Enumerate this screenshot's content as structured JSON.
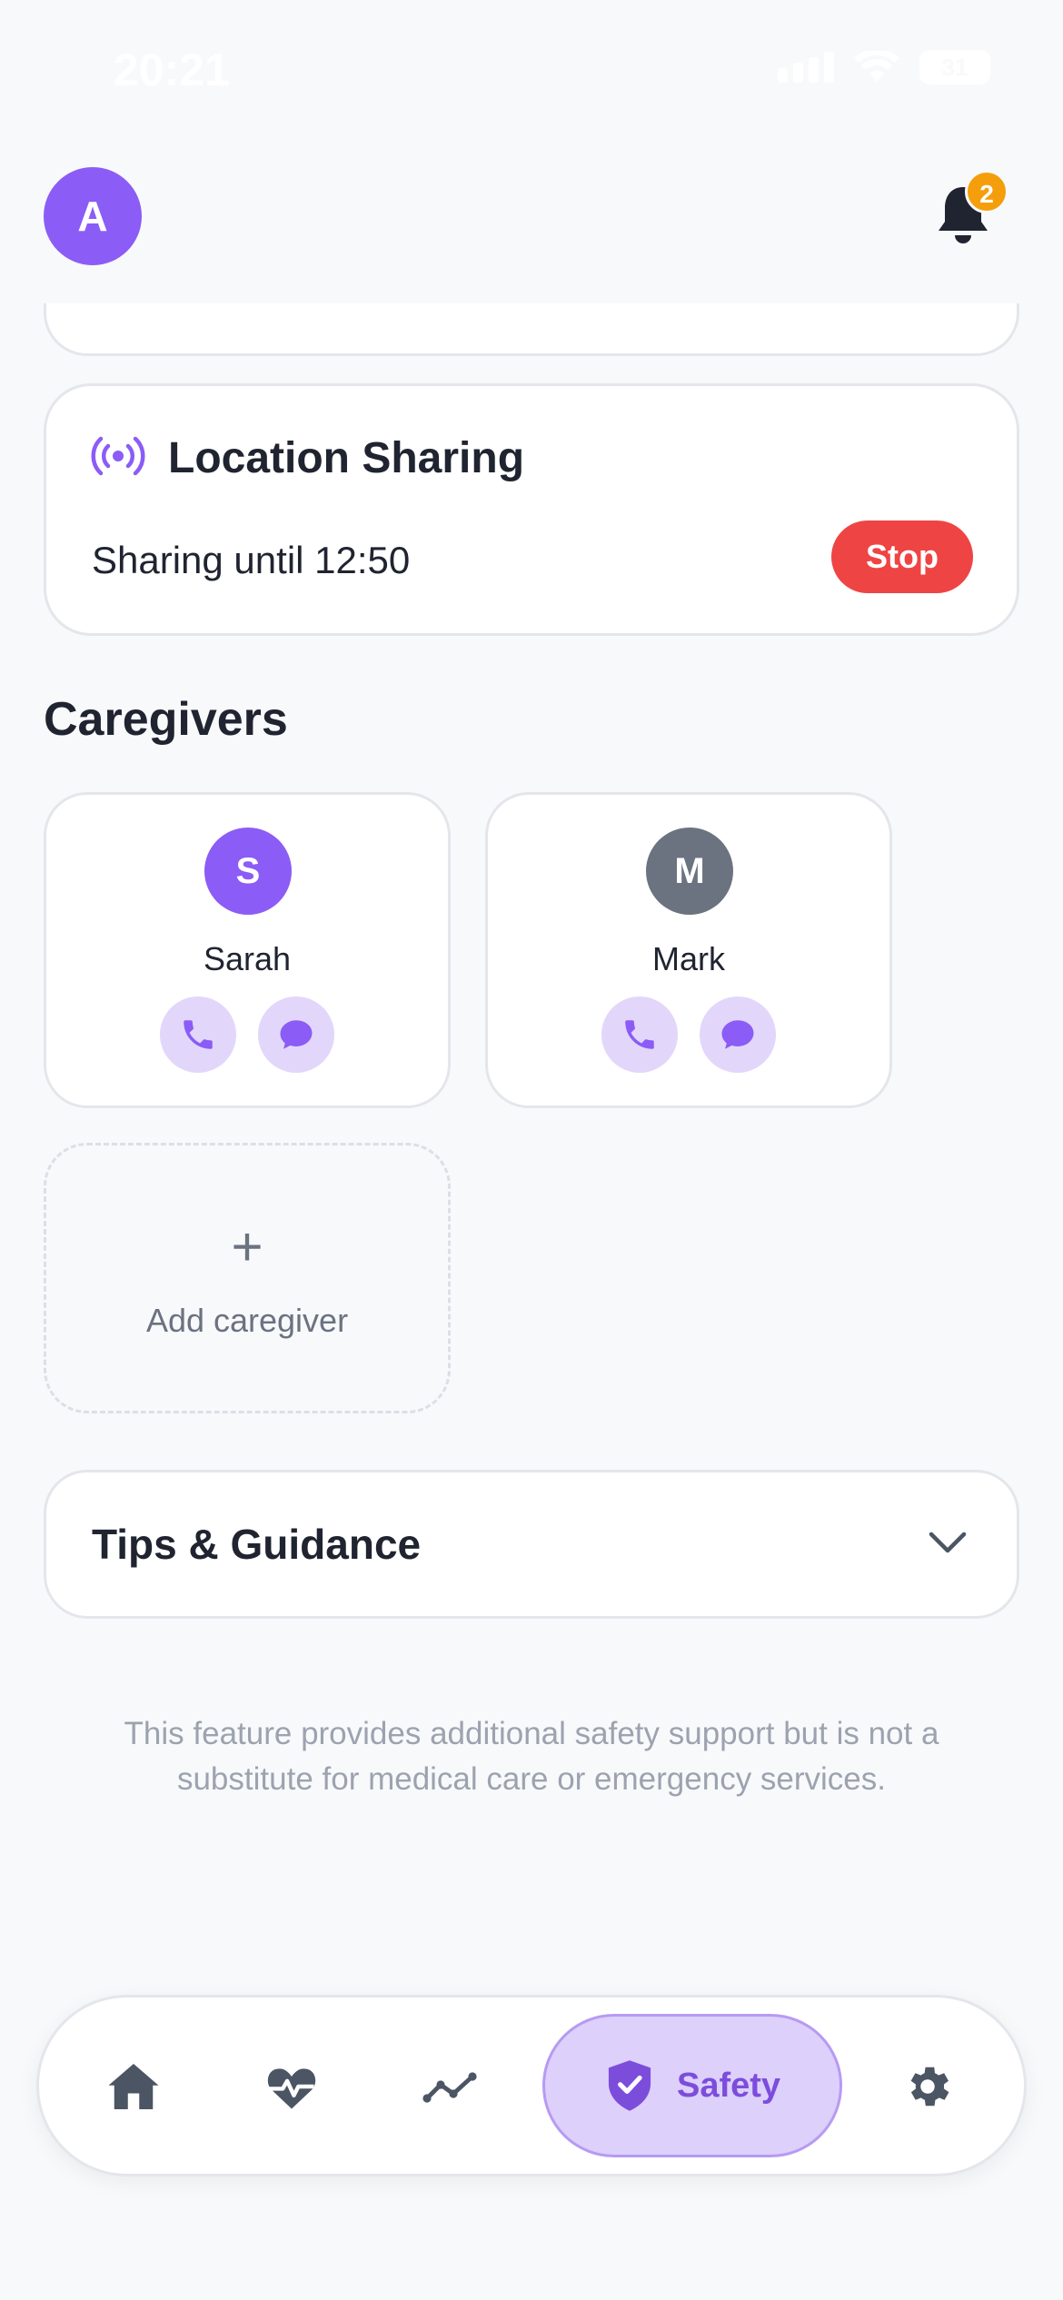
{
  "status_bar": {
    "time": "20:21",
    "battery": "31"
  },
  "header": {
    "avatar_letter": "A",
    "notification_count": "2"
  },
  "location_sharing": {
    "title": "Location Sharing",
    "status": "Sharing until 12:50",
    "stop_label": "Stop"
  },
  "caregivers": {
    "title": "Caregivers",
    "items": [
      {
        "initial": "S",
        "name": "Sarah",
        "avatar_color": "#8b5cf6"
      },
      {
        "initial": "M",
        "name": "Mark",
        "avatar_color": "#6b7280"
      }
    ],
    "add_icon": "+",
    "add_label": "Add caregiver"
  },
  "tips": {
    "title": "Tips & Guidance"
  },
  "disclaimer": "This feature provides additional safety support but is not a substitute for medical care or emergency services.",
  "bottom_nav": {
    "items": [
      "home-icon",
      "heart-pulse-icon",
      "trend-icon",
      "shield-check-icon",
      "gear-icon"
    ],
    "active_label": "Safety"
  },
  "colors": {
    "accent": "#8b5cf6",
    "danger": "#ef4444",
    "badge": "#f59e0b"
  }
}
